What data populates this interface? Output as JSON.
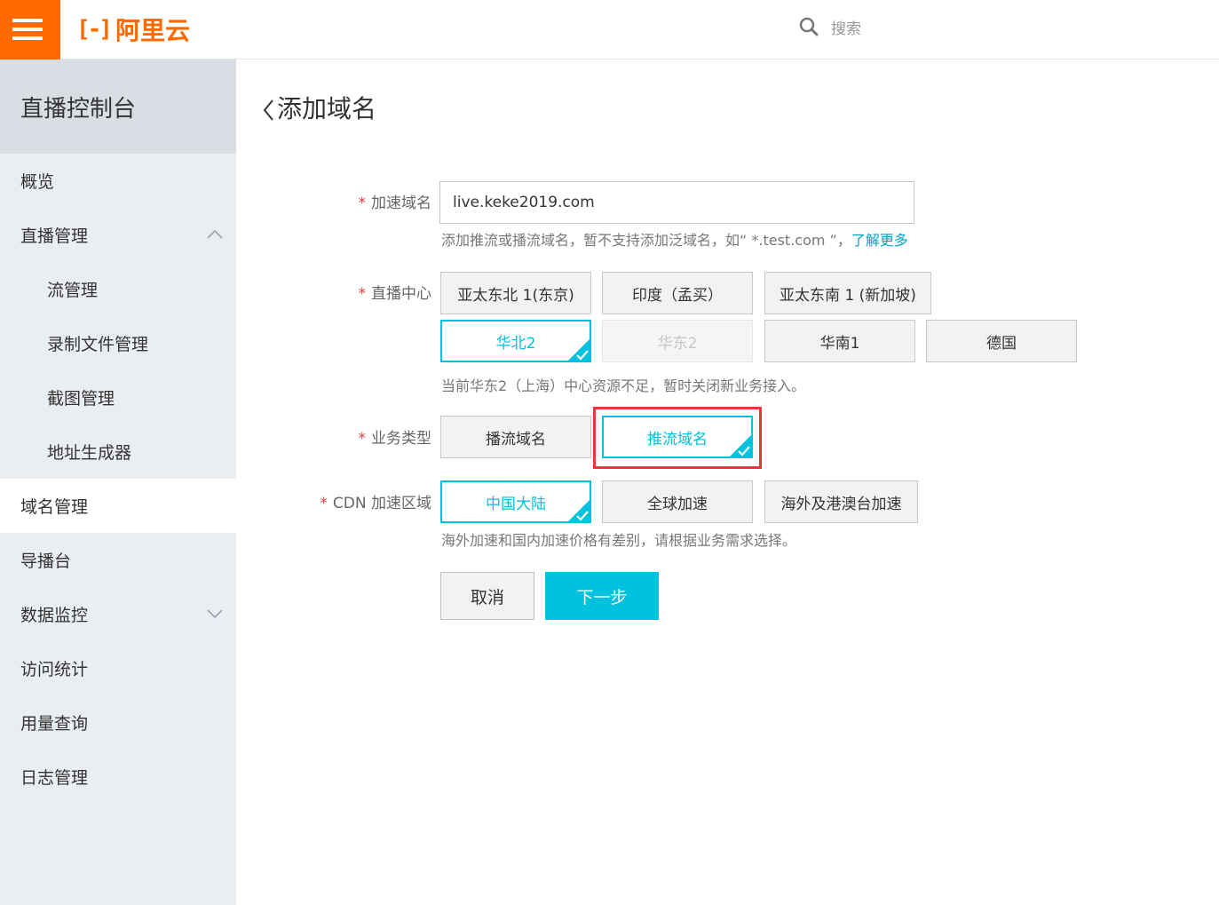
{
  "header": {
    "logo_text": "阿里云",
    "search_placeholder": "搜索"
  },
  "sidebar": {
    "title": "直播控制台",
    "items": [
      {
        "label": "概览"
      },
      {
        "label": "直播管理"
      },
      {
        "label": "流管理"
      },
      {
        "label": "录制文件管理"
      },
      {
        "label": "截图管理"
      },
      {
        "label": "地址生成器"
      },
      {
        "label": "域名管理"
      },
      {
        "label": "导播台"
      },
      {
        "label": "数据监控"
      },
      {
        "label": "访问统计"
      },
      {
        "label": "用量查询"
      },
      {
        "label": "日志管理"
      }
    ]
  },
  "page": {
    "title": "添加域名",
    "required_mark": "*",
    "domain": {
      "label": "加速域名",
      "value": "live.keke2019.com",
      "help": "添加推流或播流域名，暂不支持添加泛域名，如“ *.test.com ”，",
      "help_link": "了解更多"
    },
    "center": {
      "label": "直播中心",
      "options": [
        {
          "label": "亚太东北 1(东京)",
          "state": "normal"
        },
        {
          "label": "印度（孟买）",
          "state": "normal"
        },
        {
          "label": "亚太东南 1 (新加坡)",
          "state": "normal"
        },
        {
          "label": "华北2",
          "state": "selected"
        },
        {
          "label": "华东2",
          "state": "disabled"
        },
        {
          "label": "华南1",
          "state": "normal"
        },
        {
          "label": "德国",
          "state": "normal"
        }
      ],
      "help": "当前华东2（上海）中心资源不足，暂时关闭新业务接入。"
    },
    "type": {
      "label": "业务类型",
      "options": [
        {
          "label": "播流域名",
          "state": "normal"
        },
        {
          "label": "推流域名",
          "state": "selected"
        }
      ]
    },
    "cdn": {
      "label": "CDN 加速区域",
      "options": [
        {
          "label": "中国大陆",
          "state": "selected"
        },
        {
          "label": "全球加速",
          "state": "normal"
        },
        {
          "label": "海外及港澳台加速",
          "state": "normal"
        }
      ],
      "help": "海外加速和国内加速价格有差别，请根据业务需求选择。"
    },
    "buttons": {
      "cancel": "取消",
      "next": "下一步"
    }
  },
  "colors": {
    "brand": "#ff6a00",
    "accent": "#00c1de",
    "highlight": "#e4393c"
  }
}
